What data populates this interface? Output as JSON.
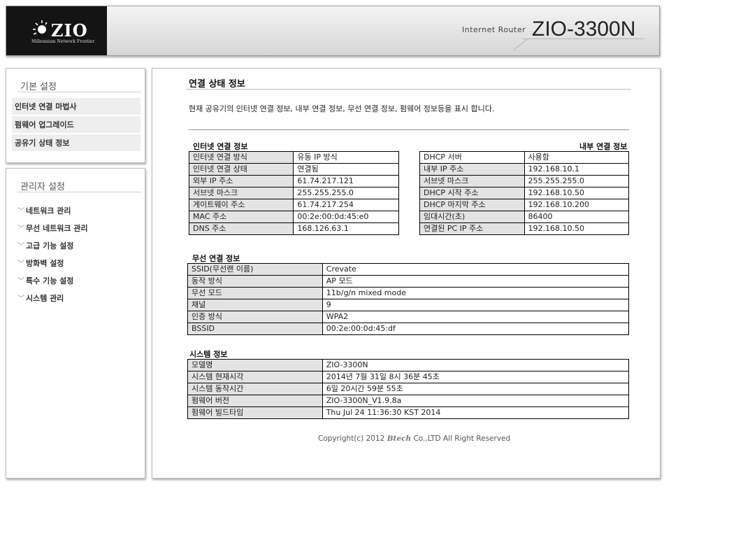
{
  "header": {
    "logo_brand": "ZIO",
    "logo_tagline": "Millennium Network Frontier",
    "router_label": "Internet Router",
    "model_label": "ZIO-3300N"
  },
  "sidebar": {
    "basic_title": "기본 설정",
    "basic_items": [
      "인터넷 연결 마법사",
      "펌웨어 업그레이드",
      "공유기 상태 정보"
    ],
    "admin_title": "관리자 설정",
    "admin_items": [
      "네트워크 관리",
      "무선 네트워크 관리",
      "고급 기능 설정",
      "방화벽 설정",
      "특수 기능 설정",
      "시스템 관리"
    ]
  },
  "main": {
    "title": "연결 상태 정보",
    "description": "현재 공유기의 인터넷 연결 정보, 내부 연결 정보, 무선 연결 정보, 펌웨어 정보등을 표시 합니다.",
    "internet": {
      "title": "인터넷 연결 정보",
      "rows": [
        {
          "k": "인터넷 연결 방식",
          "v": "유동 IP 방식"
        },
        {
          "k": "인터넷 연결 상태",
          "v": "연결됨"
        },
        {
          "k": "외부 IP 주소",
          "v": "61.74.217.121"
        },
        {
          "k": "서브넷 마스크",
          "v": "255.255.255.0"
        },
        {
          "k": "게이트웨이 주소",
          "v": "61.74.217.254"
        },
        {
          "k": "MAC 주소",
          "v": "00:2e:00:0d:45:e0"
        },
        {
          "k": "DNS 주소",
          "v": "168.126.63.1"
        }
      ]
    },
    "internal": {
      "title": "내부 연결 정보",
      "rows": [
        {
          "k": "DHCP 서버",
          "v": "사용함"
        },
        {
          "k": "내부 IP 주소",
          "v": "192.168.10.1"
        },
        {
          "k": "서브넷 마스크",
          "v": "255.255.255.0"
        },
        {
          "k": "DHCP 시작 주소",
          "v": "192.168.10.50"
        },
        {
          "k": "DHCP 마지막 주소",
          "v": "192.168.10.200"
        },
        {
          "k": "임대시간(초)",
          "v": "86400"
        },
        {
          "k": "연결된 PC IP 주소",
          "v": "192.168.10.50"
        }
      ]
    },
    "wireless": {
      "title": "무선 연결 정보",
      "rows": [
        {
          "k": "SSID(무선랜 이름)",
          "v": "Crevate"
        },
        {
          "k": "동작 방식",
          "v": "AP 모드"
        },
        {
          "k": "무선 모드",
          "v": "11b/g/n mixed mode"
        },
        {
          "k": "채널",
          "v": "9"
        },
        {
          "k": "인증 방식",
          "v": "WPA2"
        },
        {
          "k": "BSSID",
          "v": "00:2e:00:0d:45:df"
        }
      ]
    },
    "system": {
      "title": "시스템 정보",
      "rows": [
        {
          "k": "모델명",
          "v": "ZIO-3300N"
        },
        {
          "k": "시스템 현재시각",
          "v": "2014년 7월 31일 8시 36분 45초"
        },
        {
          "k": "시스템 동작시간",
          "v": "6일 20시간 59분 55초"
        },
        {
          "k": "펌웨어 버전",
          "v": "ZIO-3300N_V1.9.8a"
        },
        {
          "k": "펌웨어 빌드타임",
          "v": "Thu Jul 24 11:36:30 KST 2014"
        }
      ]
    },
    "copyright_prefix": "Copyright(c) 2012",
    "copyright_brand": "Btech",
    "copyright_suffix": "Co.,LTD All Right Reserved"
  }
}
